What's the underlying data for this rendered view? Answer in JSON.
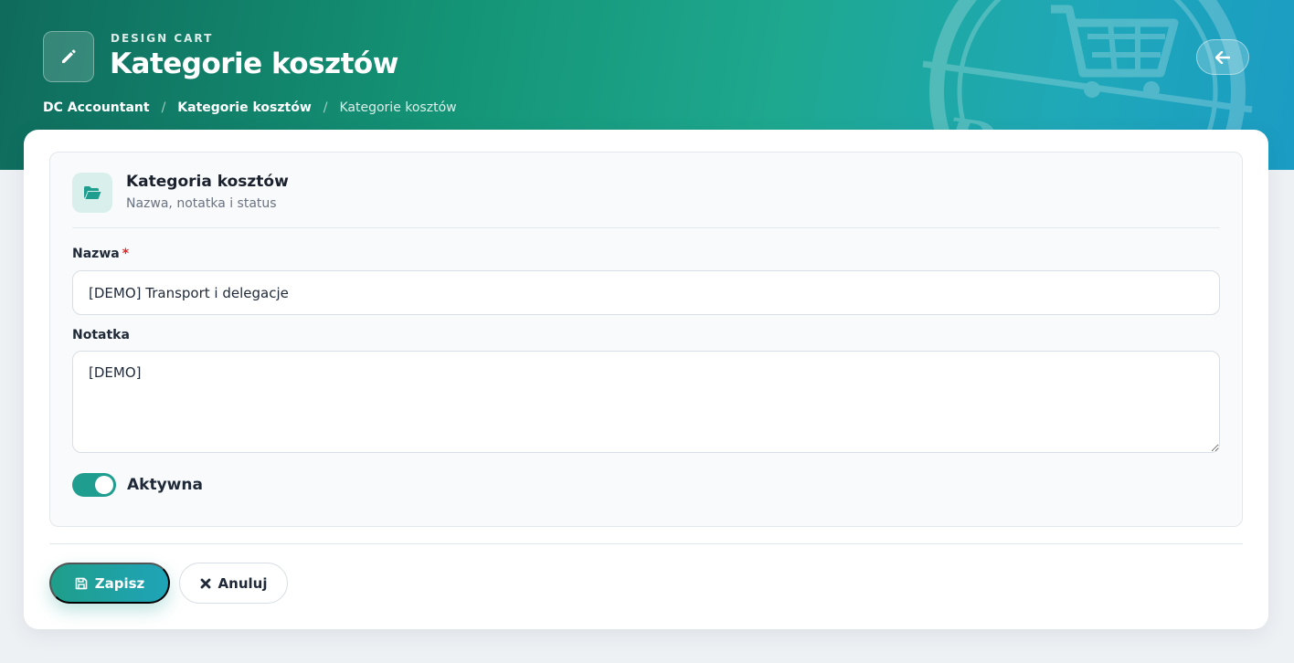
{
  "header": {
    "eyebrow": "DESIGN CART",
    "title": "Kategorie kosztów",
    "edit_icon": "pencil-icon",
    "back_icon": "arrow-left-icon",
    "logo_text": "Design"
  },
  "breadcrumb": {
    "items": [
      {
        "label": "DC Accountant"
      },
      {
        "label": "Kategorie kosztów"
      },
      {
        "label": "Kategorie kosztów"
      }
    ],
    "separator": "/"
  },
  "section": {
    "icon": "folder-open-icon",
    "title": "Kategoria kosztów",
    "subtitle": "Nazwa, notatka i status"
  },
  "form": {
    "name_label": "Nazwa",
    "required_mark": "*",
    "name_value": "[DEMO] Transport i delegacje",
    "note_label": "Notatka",
    "note_value": "[DEMO]",
    "active_label": "Aktywna",
    "active": true
  },
  "actions": {
    "save_label": "Zapisz",
    "cancel_label": "Anuluj"
  },
  "colors": {
    "accent": "#1f9e90",
    "required": "#dc2626"
  }
}
